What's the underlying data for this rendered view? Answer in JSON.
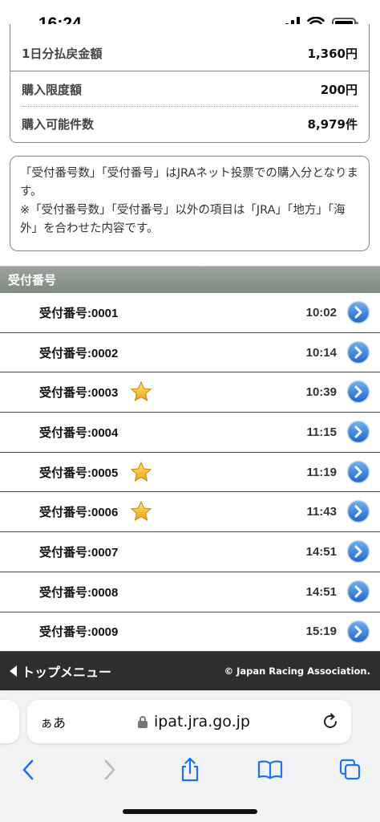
{
  "status_bar": {
    "time": "16:24"
  },
  "summary": {
    "rows": [
      {
        "label": "1日分払戻金額",
        "value": "1,360円"
      },
      {
        "label": "購入限度額",
        "value": "200円"
      },
      {
        "label": "購入可能件数",
        "value": "8,979件"
      }
    ]
  },
  "note": {
    "line1": "「受付番号数」「受付番号」はJRAネット投票での購入分となります。",
    "line2": "※「受付番号数」「受付番号」以外の項目は「JRA」「地方」「海外」を合わせた内容です。"
  },
  "section": {
    "title": "受付番号"
  },
  "receipts": [
    {
      "label": "受付番号:0001",
      "time": "10:02",
      "starred": false
    },
    {
      "label": "受付番号:0002",
      "time": "10:14",
      "starred": false
    },
    {
      "label": "受付番号:0003",
      "time": "10:39",
      "starred": true
    },
    {
      "label": "受付番号:0004",
      "time": "11:15",
      "starred": false
    },
    {
      "label": "受付番号:0005",
      "time": "11:19",
      "starred": true
    },
    {
      "label": "受付番号:0006",
      "time": "11:43",
      "starred": true
    },
    {
      "label": "受付番号:0007",
      "time": "14:51",
      "starred": false
    },
    {
      "label": "受付番号:0008",
      "time": "14:51",
      "starred": false
    },
    {
      "label": "受付番号:0009",
      "time": "15:19",
      "starred": false
    }
  ],
  "footer": {
    "top_menu": "トップメニュー",
    "copyright": "© Japan Racing Association."
  },
  "browser": {
    "aa": "ぁあ",
    "url": "ipat.jra.go.jp"
  },
  "icons": {
    "star": "star-icon",
    "chevron": "chevron-right-circle-icon",
    "accent_blue": "#2f7fd6",
    "star_gold": "#f2b21b",
    "ios_blue": "#1a73e8"
  }
}
